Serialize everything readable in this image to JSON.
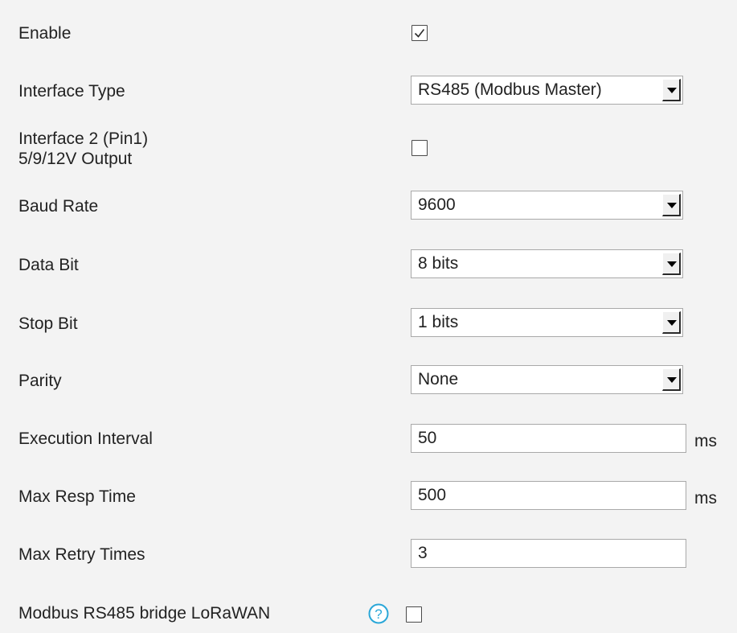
{
  "form": {
    "enable": {
      "label": "Enable",
      "checked": true
    },
    "interface_type": {
      "label": "Interface Type",
      "value": "RS485 (Modbus Master)"
    },
    "interface2_output": {
      "label_line1": "Interface 2 (Pin1)",
      "label_line2": "5/9/12V Output",
      "checked": false
    },
    "baud_rate": {
      "label": "Baud Rate",
      "value": "9600"
    },
    "data_bit": {
      "label": "Data Bit",
      "value": "8 bits"
    },
    "stop_bit": {
      "label": "Stop Bit",
      "value": "1 bits"
    },
    "parity": {
      "label": "Parity",
      "value": "None"
    },
    "execution_interval": {
      "label": "Execution Interval",
      "value": "50",
      "unit": "ms"
    },
    "max_resp_time": {
      "label": "Max Resp Time",
      "value": "500",
      "unit": "ms"
    },
    "max_retry_times": {
      "label": "Max Retry Times",
      "value": "3"
    },
    "bridge_lorawan": {
      "label": "Modbus RS485 bridge LoRaWAN",
      "checked": false,
      "help_icon": "question-circle-icon"
    }
  },
  "colors": {
    "panel_background": "#f3f3f3",
    "help_icon": "#2aa7d8",
    "field_border": "#a9a9a9"
  }
}
